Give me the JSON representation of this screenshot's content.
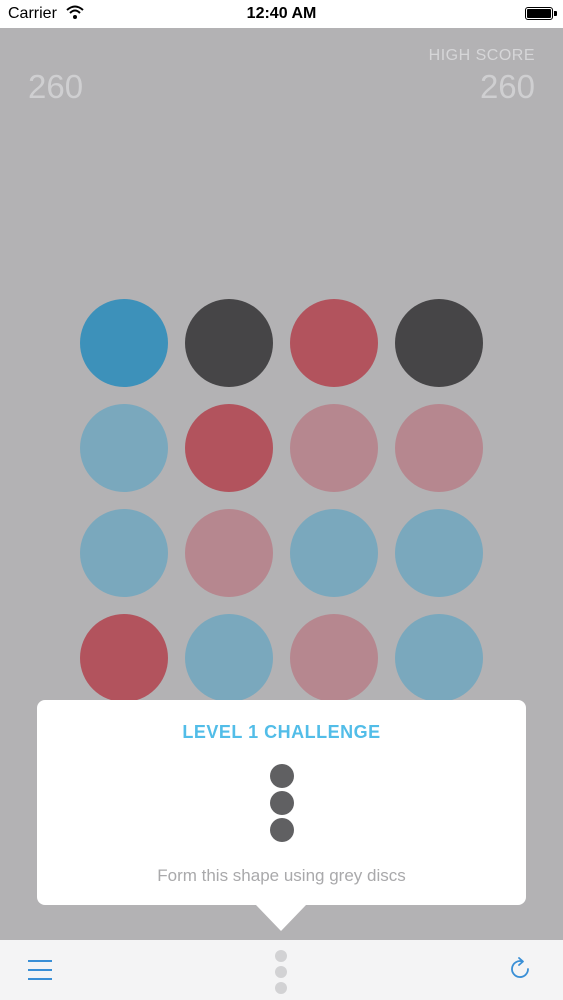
{
  "status_bar": {
    "carrier": "Carrier",
    "time": "12:40 AM"
  },
  "score": {
    "current": "260",
    "high_label": "HIGH SCORE",
    "high_value": "260"
  },
  "board": {
    "rows": [
      [
        "blue",
        "dark",
        "red",
        "dark"
      ],
      [
        "light-blue",
        "red",
        "light-red",
        "light-red"
      ],
      [
        "light-blue",
        "light-red",
        "light-blue",
        "light-blue"
      ],
      [
        "red",
        "light-blue",
        "light-red",
        "light-blue"
      ]
    ],
    "colors": {
      "blue": "#3d91ba",
      "dark": "#464547",
      "red": "#b2535d",
      "light-blue": "#7aa8bd",
      "light-red": "#b6878f"
    }
  },
  "challenge": {
    "title": "LEVEL 1 CHALLENGE",
    "shape_discs": 3,
    "instruction": "Form this shape using grey discs",
    "title_color": "#52bde8"
  },
  "toolbar": {
    "menu_icon": "hamburger-menu-icon",
    "center_icon": "vertical-dots-icon",
    "refresh_icon": "refresh-icon",
    "accent_color": "#3a8fd6"
  }
}
